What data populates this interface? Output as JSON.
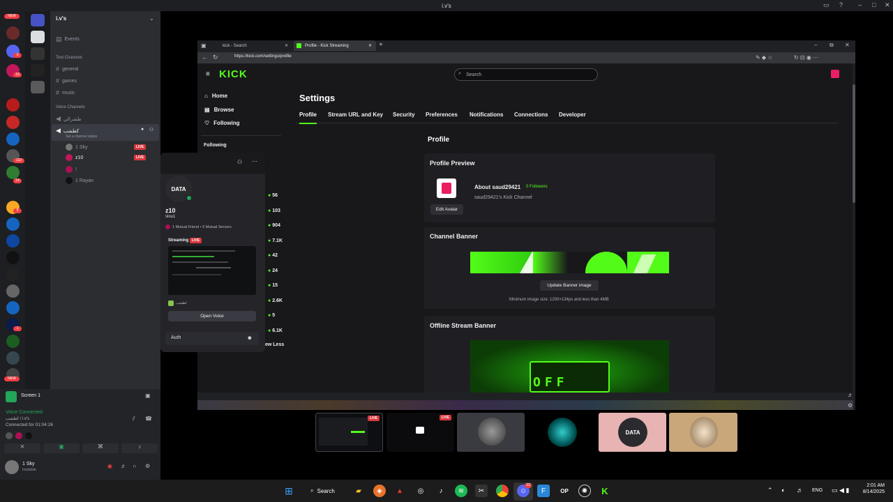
{
  "discord": {
    "window_title": "i.v's",
    "server_name": "i.v's",
    "events": "Events",
    "text_category": "Text Channels",
    "text_channels": [
      "general",
      "games",
      "music"
    ],
    "voice_category": "Voice Channels",
    "voice_channels": [
      "طشرالي",
      "كطشب"
    ],
    "channel_status": "Set a channel status",
    "voice_users": [
      {
        "name": "1 Sky",
        "live": "LIVE"
      },
      {
        "name": "z10",
        "live": "LIVE"
      },
      {
        "name": "!",
        "live": ""
      },
      {
        "name": "1 Rayan",
        "live": ""
      }
    ],
    "rail_badges": [
      "NEW",
      "3",
      "19",
      "132",
      "14",
      "6",
      "1",
      "NEW"
    ],
    "screen_label": "Screen 1",
    "voice_connected": "Voice Connected",
    "voice_sub": "كطشب / i.v's",
    "connected_for": "Connected for 01:04:26",
    "user_name": "1 Sky",
    "user_status": "Invisible",
    "member_counts": [
      "56",
      "103",
      "904",
      "7.1K",
      "42",
      "24",
      "15",
      "2.6K",
      "5",
      "6.1K"
    ],
    "view_less": "ew Less",
    "following": "Following"
  },
  "popout": {
    "avatar_text": "DATA",
    "username": "z10",
    "tag": "slou1",
    "mutuals": "1 Mutual Friend • 5 Mutual Servers",
    "streaming_label": "Streaming",
    "live": "LIVE",
    "channel_line": "كطشب",
    "open_voice": "Open Voice",
    "message_value": "Auth"
  },
  "browser": {
    "tab1": "kick - Search",
    "tab2": "Profile - Kick Streaming",
    "url": "https://kick.com/settings/profile"
  },
  "kick": {
    "logo": "KICK",
    "search_placeholder": "Search",
    "nav": [
      "Home",
      "Browse",
      "Following"
    ],
    "settings_title": "Settings",
    "tabs": [
      "Profile",
      "Stream URL and Key",
      "Security",
      "Preferences",
      "Notifications",
      "Connections",
      "Developer"
    ],
    "section_title": "Profile",
    "preview_title": "Profile Preview",
    "about": "About saud29421",
    "followers": "0 Followers",
    "channel_desc": "saud29421's Kick Channel",
    "edit_avatar": "Edit Avatar",
    "banner_title": "Channel Banner",
    "update_banner": "Update Banner image",
    "banner_hint": "Minimum image size: 1200×134px and less than 4MB",
    "offline_title": "Offline Stream Banner",
    "offline_text": "OFF"
  },
  "thumbs": {
    "live1": "LIVE",
    "live2": "LIVE",
    "data_avatar": "DATA"
  },
  "taskbar": {
    "search": "Search",
    "lang": "ENG",
    "time": "2:01 AM",
    "date": "8/14/2025",
    "discord_badge": "23"
  },
  "colors": {
    "kick_green": "#53fc18",
    "discord_red": "#da373c",
    "discord_green": "#23a55a"
  }
}
